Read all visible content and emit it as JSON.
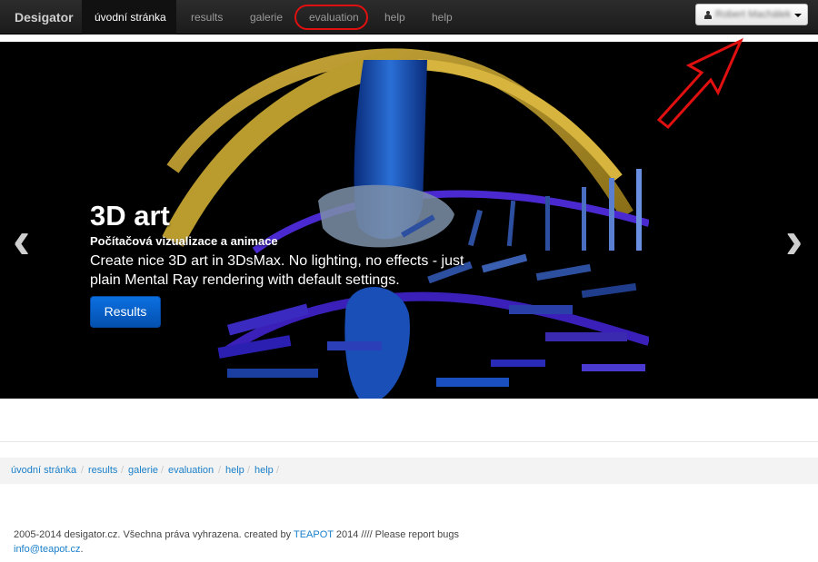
{
  "navbar": {
    "brand": "Desigator",
    "items": [
      {
        "label": "úvodní stránka",
        "active": true
      },
      {
        "label": "results"
      },
      {
        "label": "galerie"
      },
      {
        "label": "evaluation",
        "highlighted": true
      },
      {
        "label": "help"
      },
      {
        "label": "help"
      }
    ],
    "user_name": "Robert Machálek",
    "user_icon": "user-icon"
  },
  "hero": {
    "title": "3D art",
    "subtitle": "Počítačová vizualizace a animace",
    "description": "Create nice 3D art in 3DsMax. No lighting, no effects - just plain Mental Ray rendering with default settings.",
    "button_label": "Results",
    "prev_icon": "‹",
    "next_icon": "›"
  },
  "breadcrumb": [
    "úvodní stránka",
    "results",
    "galerie",
    "evaluation",
    "help",
    "help"
  ],
  "breadcrumb_separator": "/",
  "footer": {
    "text1": "2005-2014 desigator.cz. Všechna práva vyhrazena. created by ",
    "link1": "TEAPOT",
    "text2": " 2014 //// Please report bugs ",
    "link2": "info@teapot.cz",
    "text3": "."
  },
  "colors": {
    "annotation": "#e01010",
    "link": "#1a7fc9",
    "button": "#0b6fe0"
  }
}
